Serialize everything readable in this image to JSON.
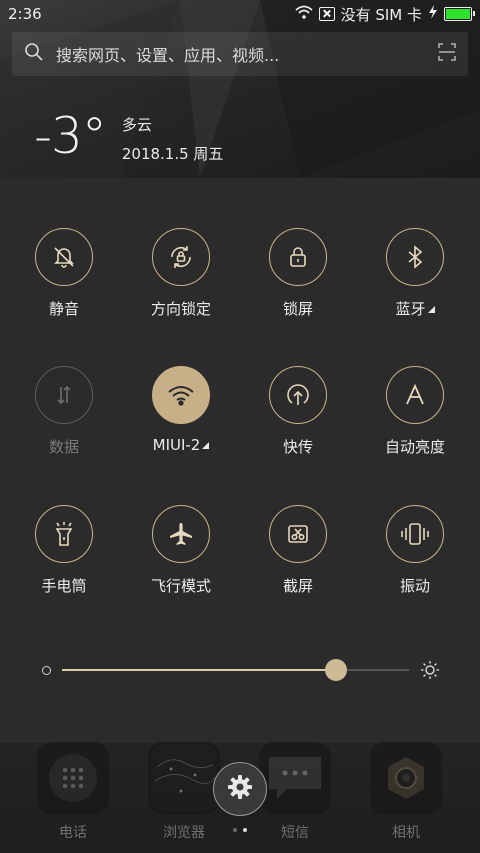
{
  "status_bar": {
    "time": "2:36",
    "carrier_text": "没有 SIM 卡",
    "battery_color": "#2ee12e"
  },
  "search": {
    "placeholder": "搜索网页、设置、应用、视频..."
  },
  "weather": {
    "temperature": "-3°",
    "condition": "多云",
    "date": "2018.1.5 周五"
  },
  "toggles": [
    {
      "label": "静音",
      "icon": "bell-off-icon",
      "state": "off"
    },
    {
      "label": "方向锁定",
      "icon": "rotation-lock-icon",
      "state": "off"
    },
    {
      "label": "锁屏",
      "icon": "lock-icon",
      "state": "off"
    },
    {
      "label": "蓝牙",
      "icon": "bluetooth-icon",
      "state": "off",
      "has_more": true
    },
    {
      "label": "数据",
      "icon": "mobile-data-icon",
      "state": "disabled"
    },
    {
      "label": "MIUI-2",
      "icon": "wifi-icon",
      "state": "on",
      "has_more": true
    },
    {
      "label": "快传",
      "icon": "transfer-icon",
      "state": "off"
    },
    {
      "label": "自动亮度",
      "icon": "auto-brightness-icon",
      "state": "off"
    },
    {
      "label": "手电筒",
      "icon": "flashlight-icon",
      "state": "off"
    },
    {
      "label": "飞行模式",
      "icon": "airplane-icon",
      "state": "off"
    },
    {
      "label": "截屏",
      "icon": "screenshot-icon",
      "state": "off"
    },
    {
      "label": "振动",
      "icon": "vibrate-icon",
      "state": "off"
    }
  ],
  "brightness": {
    "level": 0.79
  },
  "dock": {
    "apps": [
      {
        "label": "电话",
        "icon": "phone-dialpad-icon"
      },
      {
        "label": "浏览器",
        "icon": "browser-icon"
      },
      {
        "label": "短信",
        "icon": "messages-icon"
      },
      {
        "label": "相机",
        "icon": "camera-icon"
      }
    ]
  },
  "colors": {
    "accent": "#c7b088",
    "background": "#2b2b2b"
  }
}
